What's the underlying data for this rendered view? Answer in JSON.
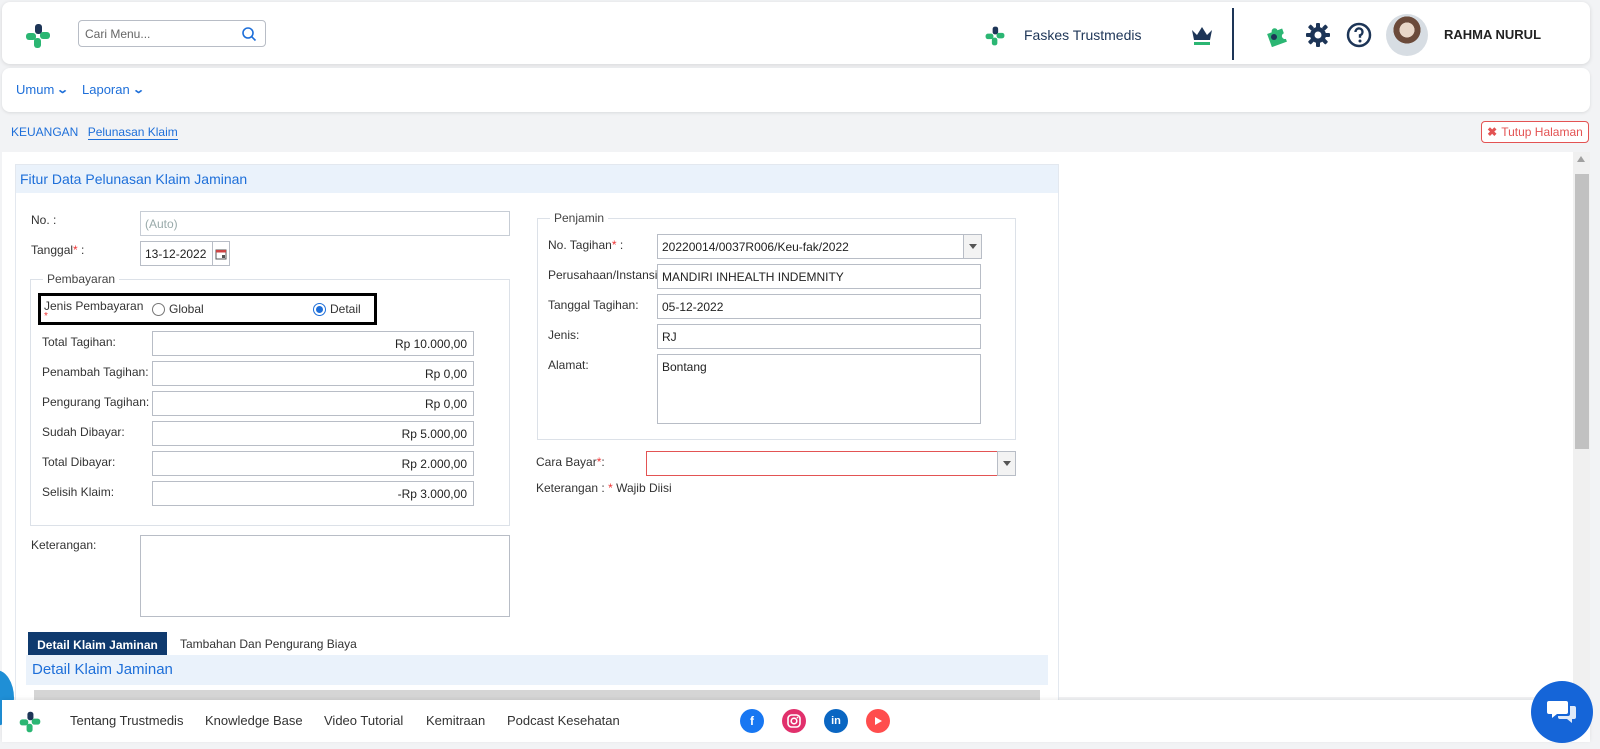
{
  "header": {
    "search_placeholder": "Cari Menu...",
    "faskes_name": "Faskes Trustmedis",
    "user_name": "RAHMA NURUL"
  },
  "menu": {
    "items": [
      {
        "label": "Umum"
      },
      {
        "label": "Laporan"
      }
    ]
  },
  "breadcrumb": {
    "root": "KEUANGAN",
    "current": "Pelunasan Klaim"
  },
  "close_page_label": "Tutup Halaman",
  "form": {
    "title": "Fitur Data Pelunasan Klaim Jaminan",
    "no": {
      "label": "No. :",
      "value": "(Auto)"
    },
    "tanggal": {
      "label": "Tanggal",
      "req": "*",
      "suffix": " :",
      "value": "13-12-2022"
    },
    "pembayaran": {
      "legend": "Pembayaran",
      "jenis_label": "Jenis Pembayaran",
      "req": "*",
      "options": [
        "Global",
        "Detail"
      ],
      "selected": "Detail",
      "fields": [
        {
          "label": "Total Tagihan:",
          "value": "Rp 10.000,00"
        },
        {
          "label": "Penambah Tagihan:",
          "value": "Rp 0,00"
        },
        {
          "label": "Pengurang Tagihan:",
          "value": "Rp 0,00"
        },
        {
          "label": "Sudah Dibayar:",
          "value": "Rp 5.000,00"
        },
        {
          "label": "Total Dibayar:",
          "value": "Rp 2.000,00"
        },
        {
          "label": "Selisih Klaim:",
          "value": "-Rp 3.000,00"
        }
      ]
    },
    "keterangan_label": "Keterangan:",
    "keterangan_value": "",
    "penjamin": {
      "legend": "Penjamin",
      "no_tagihan": {
        "label": "No. Tagihan",
        "req": "*",
        "suffix": " :",
        "value": "20220014/0037R006/Keu-fak/2022"
      },
      "perusahaan": {
        "label": "Perusahaan/Instansi:",
        "value": "MANDIRI INHEALTH INDEMNITY"
      },
      "tanggal_tagihan": {
        "label": "Tanggal Tagihan:",
        "value": "05-12-2022"
      },
      "jenis": {
        "label": "Jenis:",
        "value": "RJ"
      },
      "alamat": {
        "label": "Alamat:",
        "value": "Bontang"
      }
    },
    "cara_bayar": {
      "label": "Cara Bayar",
      "req": "*",
      "suffix": ":",
      "value": ""
    },
    "note": {
      "prefix": "Keterangan : ",
      "req": "*",
      "text": " Wajib Diisi"
    }
  },
  "tabs": [
    {
      "label": "Detail Klaim Jaminan",
      "active": true
    },
    {
      "label": "Tambahan Dan Pengurang Biaya",
      "active": false
    }
  ],
  "subpanel_title": "Detail Klaim Jaminan",
  "footer": {
    "links": [
      "Tentang Trustmedis",
      "Knowledge Base",
      "Video Tutorial",
      "Kemitraan",
      "Podcast Kesehatan"
    ],
    "social": [
      {
        "name": "facebook-icon",
        "color": "#1877f2"
      },
      {
        "name": "instagram-icon",
        "color": "#e1306c"
      },
      {
        "name": "linkedin-icon",
        "color": "#0a66c2"
      },
      {
        "name": "youtube-icon",
        "color": "#ff4d4d"
      }
    ]
  },
  "colors": {
    "accent": "#1e6fd9",
    "navy": "#0f3a6e",
    "brand_green": "#2bb673",
    "danger": "#e35353"
  }
}
